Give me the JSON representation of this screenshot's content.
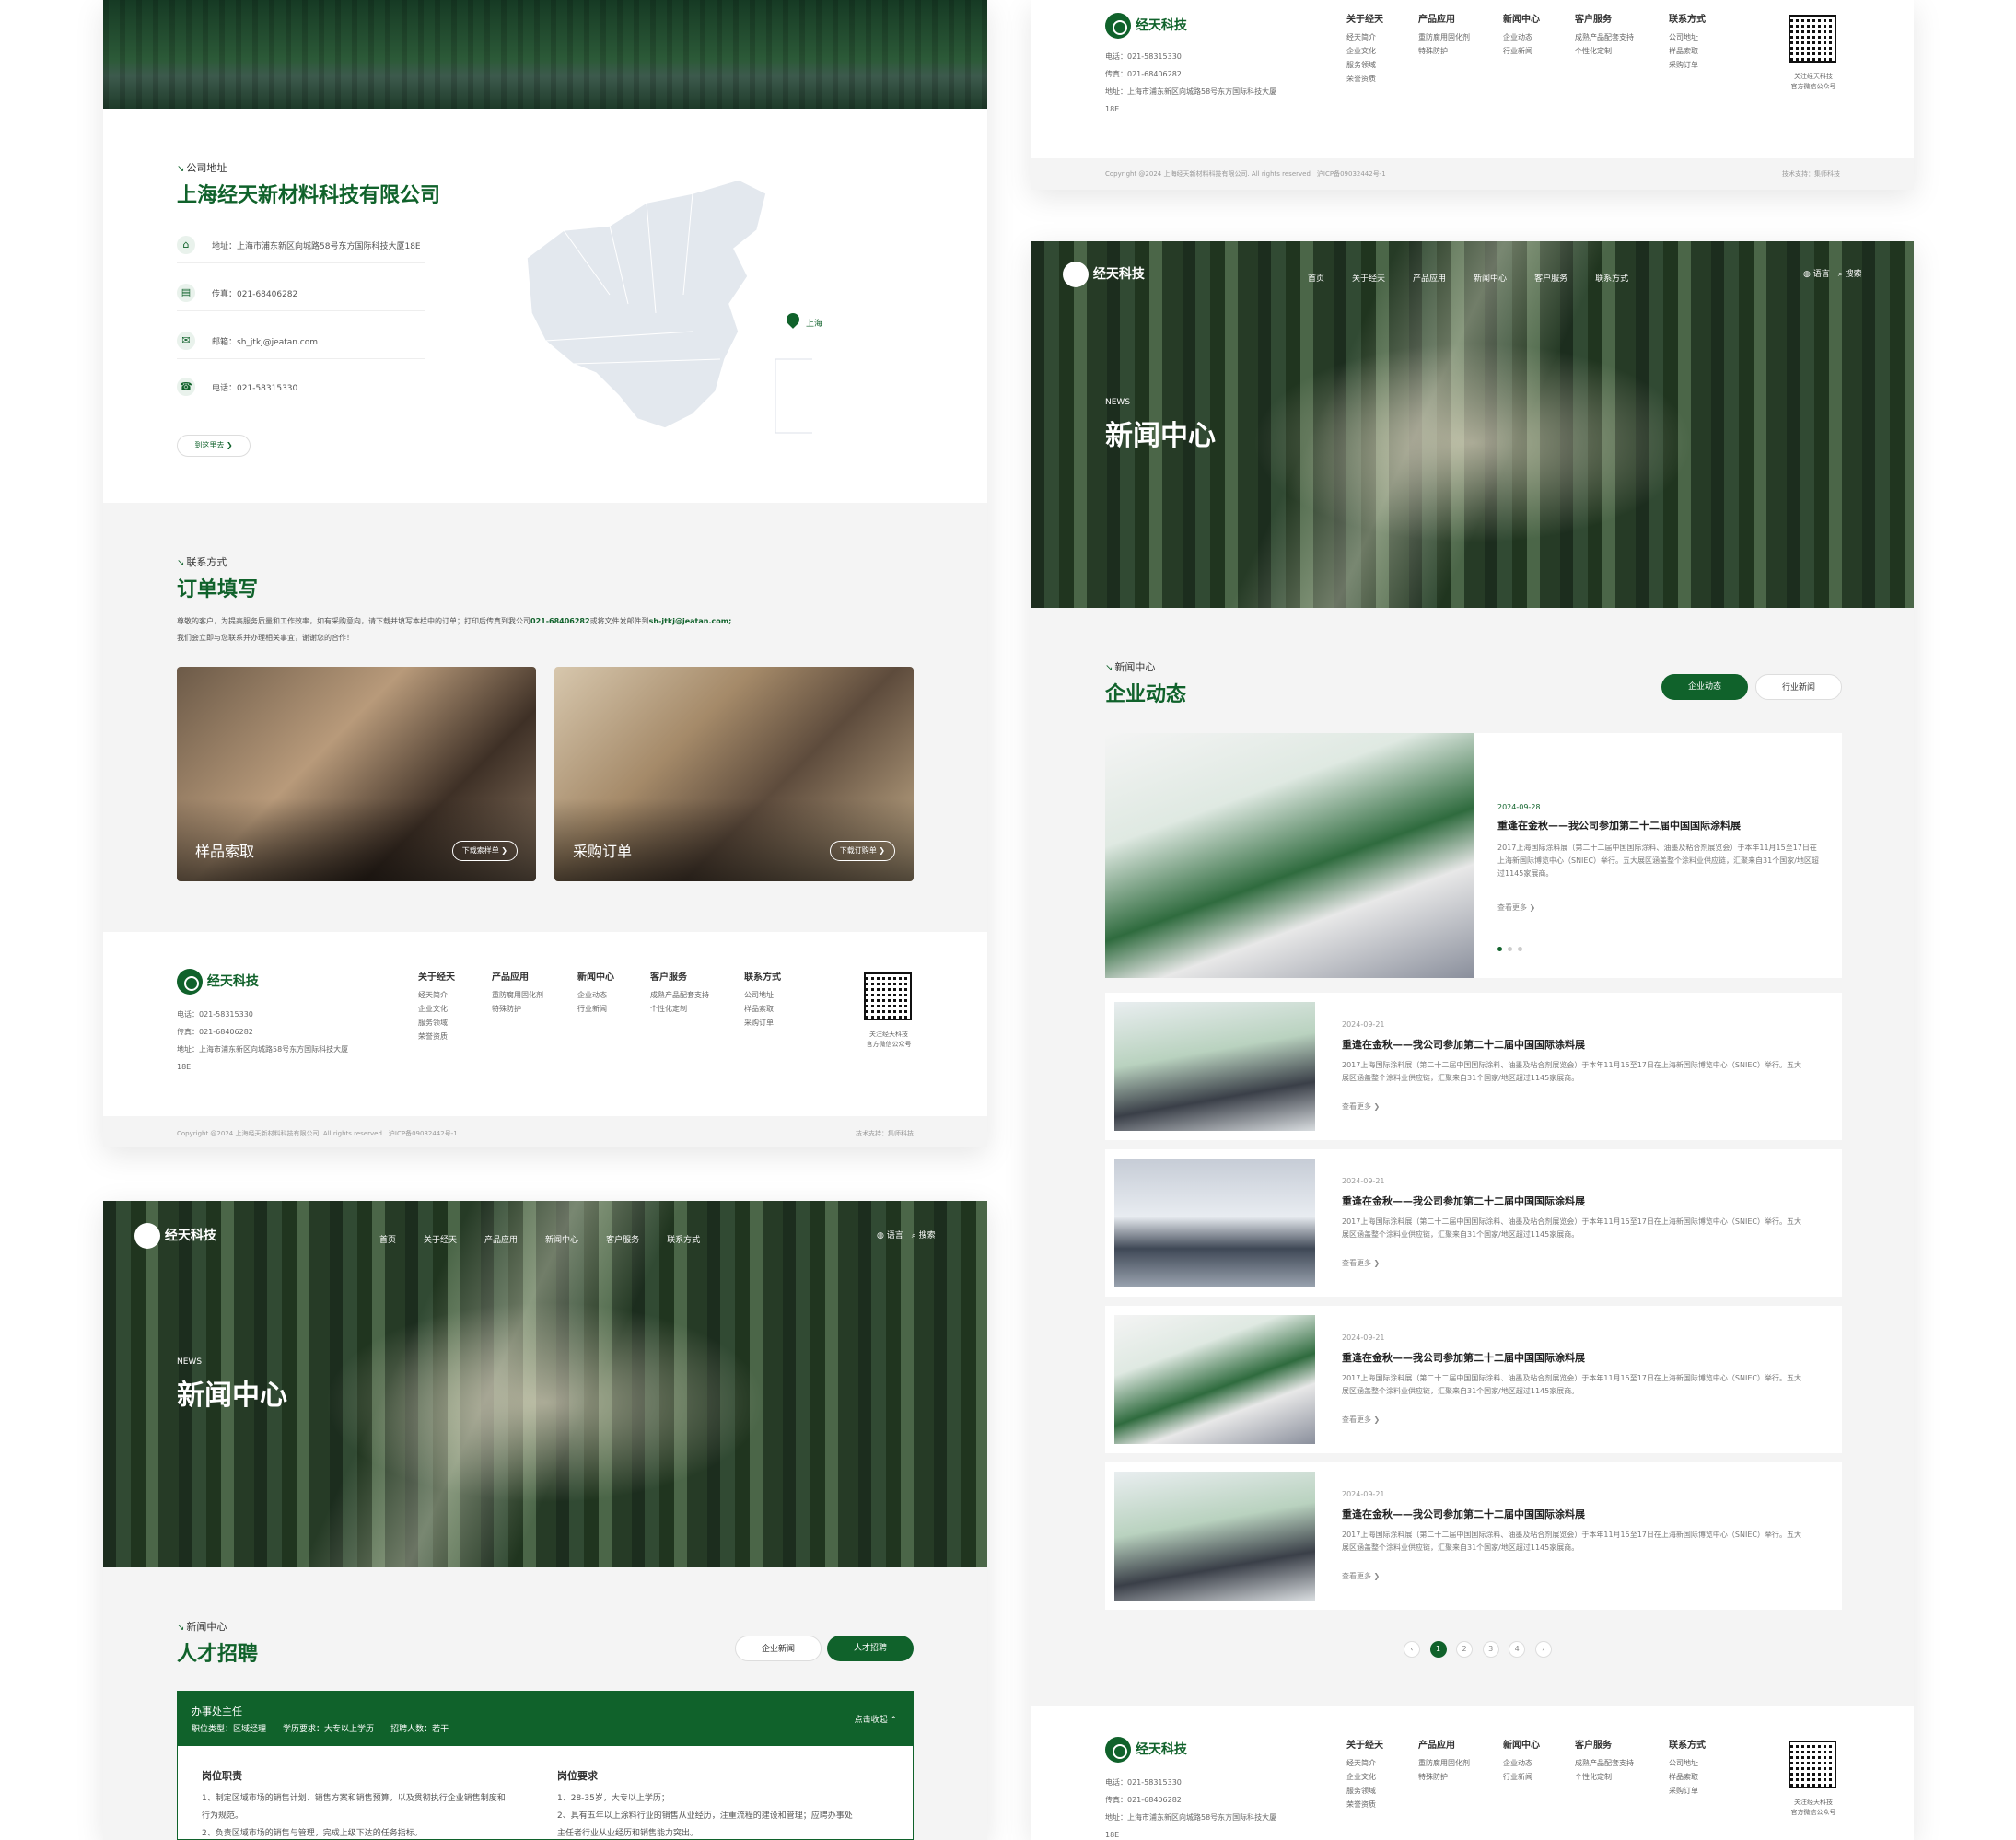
{
  "brand": {
    "name": "经天科技",
    "green": "#10622b"
  },
  "nav": [
    "首页",
    "关于经天",
    "产品应用",
    "新闻中心",
    "客户服务",
    "联系方式"
  ],
  "nav_right": {
    "lang": "语言",
    "search": "搜索"
  },
  "contact": {
    "kicker": "公司地址",
    "title": "上海经天新材料科技有限公司",
    "rows": [
      {
        "icon": "location-icon",
        "label": "地址：",
        "value": "上海市浦东新区向城路58号东方国际科技大厦18E"
      },
      {
        "icon": "fax-icon",
        "label": "传真：",
        "value": "021-68406282"
      },
      {
        "icon": "mail-icon",
        "label": "邮箱：",
        "value": "sh_jtkj@jeatan.com"
      },
      {
        "icon": "phone-icon",
        "label": "电话：",
        "value": "021-58315330"
      }
    ],
    "go_button": "到这里去",
    "map_city": "上海"
  },
  "order": {
    "kicker": "联系方式",
    "title": "订单填写",
    "intro1": "尊敬的客户，为提高服务质量和工作效率，如有采购意向，请下载并填写本栏中的订单；打印后传真到我公司",
    "phone_hl": "021-68406282",
    "intro2": "或将文件发邮件到",
    "mail_hl": "sh-jtkj@jeatan.com;",
    "intro3": "我们会立即与您联系并办理相关事宜，谢谢您的合作！",
    "cards": [
      {
        "label": "样品索取",
        "button": "下载索样单"
      },
      {
        "label": "采购订单",
        "button": "下载订购单"
      }
    ]
  },
  "footer": {
    "phone": "电话：021-58315330",
    "fax": "传真：021-68406282",
    "address": "地址：上海市浦东新区向城路58号东方国际科技大厦18E",
    "cols": [
      {
        "title": "关于经天",
        "items": [
          "经天简介",
          "企业文化",
          "服务领域",
          "荣誉资质"
        ]
      },
      {
        "title": "产品应用",
        "items": [
          "重防腐用固化剂",
          "特殊防护"
        ]
      },
      {
        "title": "新闻中心",
        "items": [
          "企业动态",
          "行业新闻"
        ]
      },
      {
        "title": "客户服务",
        "items": [
          "成熟产品配套支持",
          "个性化定制"
        ]
      },
      {
        "title": "联系方式",
        "items": [
          "公司地址",
          "样品索取",
          "采购订单"
        ]
      }
    ],
    "qr_caption1": "关注经天科技",
    "qr_caption2": "官方微信公众号",
    "copyright": "Copyright @2024 上海经天新材料科技有限公司. All rights reserved",
    "icp": "沪ICP备09032442号-1",
    "tech": "技术支持：集师科技"
  },
  "hero": {
    "kicker": "NEWS",
    "title": "新闻中心"
  },
  "news": {
    "kicker": "新闻中心",
    "title": "企业动态",
    "tabs": [
      "企业动态",
      "行业新闻"
    ],
    "featured": {
      "date": "2024-09-28",
      "title": "重逢在金秋——我公司参加第二十二届中国国际涂料展",
      "desc": "2017上海国际涂料展（第二十二届中国国际涂料、油墨及粘合剂展览会）于本年11月15至17日在上海新国际博览中心（SNIEC）举行。五大展区涵盖整个涂料业供应链，汇聚来自31个国家/地区超过1145家展商。",
      "more": "查看更多"
    },
    "items": [
      {
        "date": "2024-09-21",
        "title": "重逢在金秋——我公司参加第二十二届中国国际涂料展",
        "desc": "2017上海国际涂料展（第二十二届中国国际涂料、油墨及粘合剂展览会）于本年11月15至17日在上海新国际博览中心（SNIEC）举行。五大展区涵盖整个涂料业供应链，汇聚来自31个国家/地区超过1145家展商。",
        "more": "查看更多"
      },
      {
        "date": "2024-09-21",
        "title": "重逢在金秋——我公司参加第二十二届中国国际涂料展",
        "desc": "2017上海国际涂料展（第二十二届中国国际涂料、油墨及粘合剂展览会）于本年11月15至17日在上海新国际博览中心（SNIEC）举行。五大展区涵盖整个涂料业供应链，汇聚来自31个国家/地区超过1145家展商。",
        "more": "查看更多"
      },
      {
        "date": "2024-09-21",
        "title": "重逢在金秋——我公司参加第二十二届中国国际涂料展",
        "desc": "2017上海国际涂料展（第二十二届中国国际涂料、油墨及粘合剂展览会）于本年11月15至17日在上海新国际博览中心（SNIEC）举行。五大展区涵盖整个涂料业供应链，汇聚来自31个国家/地区超过1145家展商。",
        "more": "查看更多"
      },
      {
        "date": "2024-09-21",
        "title": "重逢在金秋——我公司参加第二十二届中国国际涂料展",
        "desc": "2017上海国际涂料展（第二十二届中国国际涂料、油墨及粘合剂展览会）于本年11月15至17日在上海新国际博览中心（SNIEC）举行。五大展区涵盖整个涂料业供应链，汇聚来自31个国家/地区超过1145家展商。",
        "more": "查看更多"
      }
    ],
    "pages": [
      "‹",
      "1",
      "2",
      "3",
      "4",
      "›"
    ]
  },
  "jobs": {
    "kicker": "新闻中心",
    "title": "人才招聘",
    "tabs": [
      "企业新闻",
      "人才招聘"
    ],
    "job_title": "办事处主任",
    "type": "职位类型：区域经理",
    "edu": "学历要求：大专以上学历",
    "count": "招聘人数：若干",
    "toggle": "点击收起",
    "duty_title": "岗位职责",
    "duty1": "1、制定区域市场的销售计划、销售方案和销售预算，以及贯彻执行企业销售制度和",
    "duty1b": "行为规范。",
    "duty2": "2、负责区域市场的销售与管理，完成上级下达的任务指标。",
    "req_title": "岗位要求",
    "req1": "1、28-35岁，大专以上学历；",
    "req2": "2、具有五年以上涂料行业的销售从业经历，注重流程的建设和管理；应聘办事处",
    "req2b": "主任者行业从业经历和销售能力突出。"
  }
}
